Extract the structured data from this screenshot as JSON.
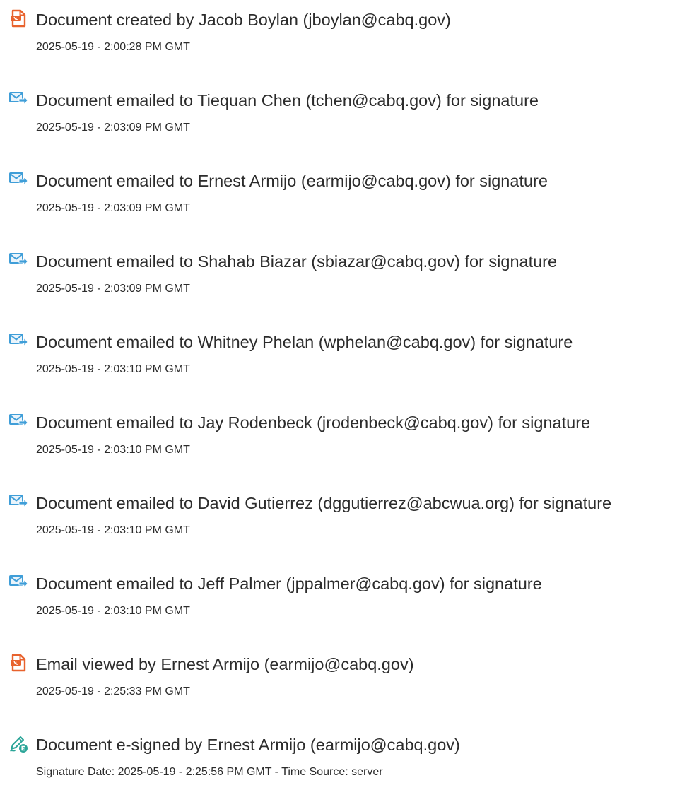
{
  "colors": {
    "created_icon": "#e8622d",
    "email_icon": "#3f9ed8",
    "signed_icon": "#2ba598",
    "text": "#2c2c2c"
  },
  "events": [
    {
      "icon": "acrobat-document-icon",
      "title": "Document created by Jacob Boylan (jboylan@cabq.gov)",
      "detail": "2025-05-19 - 2:00:28 PM GMT"
    },
    {
      "icon": "email-sent-icon",
      "title": "Document emailed to Tiequan Chen (tchen@cabq.gov) for signature",
      "detail": "2025-05-19 - 2:03:09 PM GMT"
    },
    {
      "icon": "email-sent-icon",
      "title": "Document emailed to Ernest Armijo (earmijo@cabq.gov) for signature",
      "detail": "2025-05-19 - 2:03:09 PM GMT"
    },
    {
      "icon": "email-sent-icon",
      "title": "Document emailed to Shahab Biazar (sbiazar@cabq.gov) for signature",
      "detail": "2025-05-19 - 2:03:09 PM GMT"
    },
    {
      "icon": "email-sent-icon",
      "title": "Document emailed to Whitney Phelan (wphelan@cabq.gov) for signature",
      "detail": "2025-05-19 - 2:03:10 PM GMT"
    },
    {
      "icon": "email-sent-icon",
      "title": "Document emailed to Jay Rodenbeck (jrodenbeck@cabq.gov) for signature",
      "detail": "2025-05-19 - 2:03:10 PM GMT"
    },
    {
      "icon": "email-sent-icon",
      "title": "Document emailed to David Gutierrez (dggutierrez@abcwua.org) for signature",
      "detail": "2025-05-19 - 2:03:10 PM GMT"
    },
    {
      "icon": "email-sent-icon",
      "title": "Document emailed to Jeff Palmer (jppalmer@cabq.gov) for signature",
      "detail": "2025-05-19 - 2:03:10 PM GMT"
    },
    {
      "icon": "acrobat-document-icon",
      "title": "Email viewed by Ernest Armijo (earmijo@cabq.gov)",
      "detail": "2025-05-19 - 2:25:33 PM GMT"
    },
    {
      "icon": "e-sign-pen-icon",
      "title": "Document e-signed by Ernest Armijo (earmijo@cabq.gov)",
      "detail": "Signature Date: 2025-05-19 - 2:25:56 PM GMT - Time Source: server"
    }
  ]
}
